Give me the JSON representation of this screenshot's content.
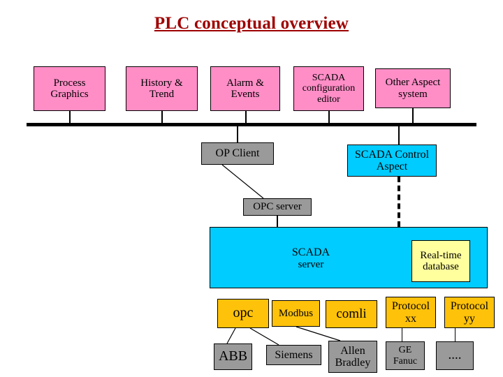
{
  "title": "PLC conceptual overview",
  "aspect_row": [
    {
      "id": "process-graphics",
      "lines": [
        "Process",
        "Graphics"
      ]
    },
    {
      "id": "history-trend",
      "lines": [
        "History &",
        "Trend"
      ]
    },
    {
      "id": "alarm-events",
      "lines": [
        "Alarm &",
        "Events"
      ]
    },
    {
      "id": "scada-configuration-editor",
      "lines": [
        "SCADA",
        "configuration",
        "editor"
      ]
    },
    {
      "id": "other-aspect-system",
      "lines": [
        "Other Aspect",
        "system"
      ]
    }
  ],
  "mid_row": {
    "op_client": {
      "lines": [
        "OP Client"
      ]
    },
    "scada_control_aspect": {
      "lines": [
        "SCADA Control",
        "Aspect"
      ]
    },
    "opc_server": {
      "lines": [
        "OPC server"
      ]
    }
  },
  "server": {
    "lines": [
      "SCADA",
      "server"
    ],
    "database": {
      "lines": [
        "Real-time",
        "database"
      ]
    }
  },
  "protocol_row": [
    {
      "id": "opc",
      "lines": [
        "opc"
      ]
    },
    {
      "id": "modbus",
      "lines": [
        "Modbus"
      ]
    },
    {
      "id": "comli",
      "lines": [
        "comli"
      ]
    },
    {
      "id": "protocol-xx",
      "lines": [
        "Protocol",
        "xx"
      ]
    },
    {
      "id": "protocol-yy",
      "lines": [
        "Protocol",
        "yy"
      ]
    }
  ],
  "vendor_row": [
    {
      "id": "abb",
      "lines": [
        "ABB"
      ]
    },
    {
      "id": "siemens",
      "lines": [
        "Siemens"
      ]
    },
    {
      "id": "allen-bradley",
      "lines": [
        "Allen",
        "Bradley"
      ]
    },
    {
      "id": "ge-fanuc",
      "lines": [
        "GE",
        "Fanuc"
      ]
    },
    {
      "id": "more",
      "lines": [
        "...."
      ]
    }
  ],
  "colors": {
    "title": "#9e0000",
    "aspect": "#ff8ec7",
    "control": "#00ccff",
    "client": "#9a9a9a",
    "protocol": "#ffc20a",
    "database": "#ffff9e",
    "line": "#000000"
  }
}
